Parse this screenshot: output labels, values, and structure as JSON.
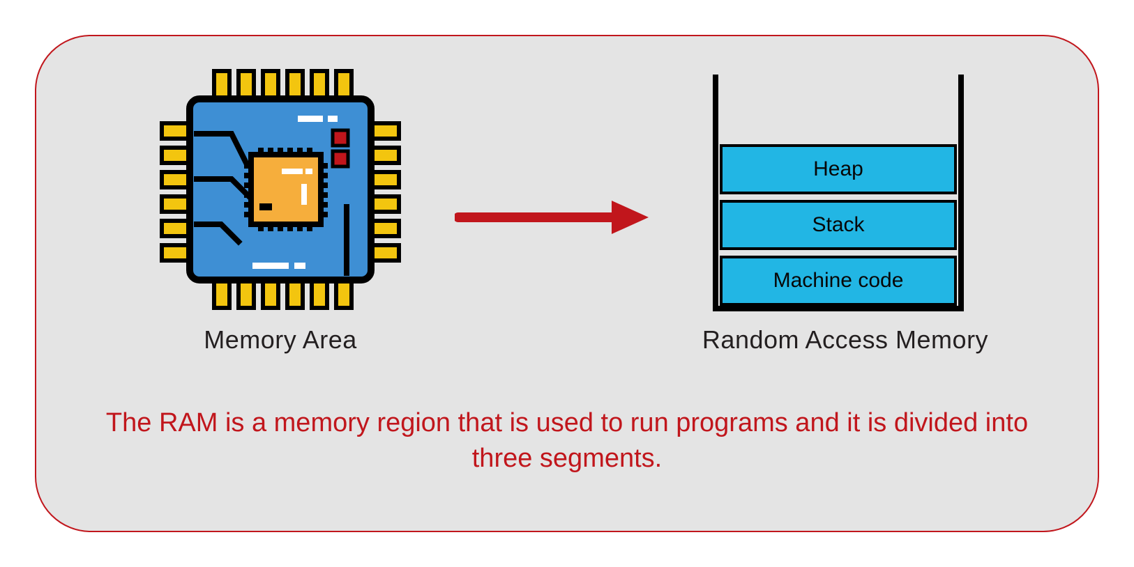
{
  "colors": {
    "border": "#C1161C",
    "panel_bg": "#E4E4E4",
    "arrow": "#C1161C",
    "ram_fill": "#22B6E4",
    "chip_body": "#3E8FD4",
    "chip_core": "#F6AE3C",
    "chip_pin": "#F3C50F",
    "text_dark": "#231f20"
  },
  "chip": {
    "label": "Memory Area",
    "icon_name": "cpu-chip-icon"
  },
  "arrow": {
    "icon_name": "arrow-right-icon"
  },
  "ram": {
    "label": "Random Access Memory",
    "segments": [
      {
        "name": "Heap"
      },
      {
        "name": "Stack"
      },
      {
        "name": "Machine code"
      }
    ]
  },
  "caption": {
    "text": "The RAM is a memory region that is used to run programs and it is divided into three segments."
  }
}
